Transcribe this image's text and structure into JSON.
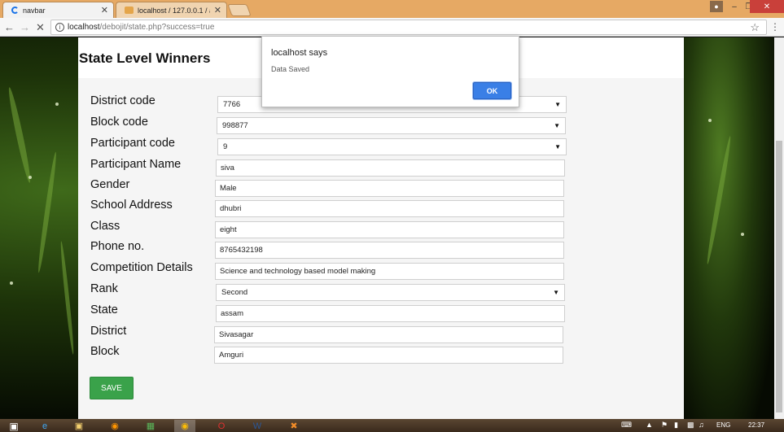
{
  "tabs": [
    {
      "title": "navbar",
      "close": "✕"
    },
    {
      "title": "localhost / 127.0.0.1 / ab",
      "close": "✕"
    }
  ],
  "address": {
    "host": "localhost",
    "path": "/debojit/state.php?success=true"
  },
  "page": {
    "title": "State Level Winners"
  },
  "form": {
    "fields": [
      {
        "label": "District code",
        "value": "7766",
        "type": "select"
      },
      {
        "label": "Block code",
        "value": "998877",
        "type": "select"
      },
      {
        "label": "Participant code",
        "value": "9",
        "type": "select"
      },
      {
        "label": "Participant Name",
        "value": "siva",
        "type": "text"
      },
      {
        "label": "Gender",
        "value": "Male",
        "type": "text"
      },
      {
        "label": "School Address",
        "value": "dhubri",
        "type": "text"
      },
      {
        "label": "Class",
        "value": "eight",
        "type": "text"
      },
      {
        "label": "Phone no.",
        "value": "8765432198",
        "type": "text"
      },
      {
        "label": "Competition Details",
        "value": "Science and technology based model making",
        "type": "text"
      },
      {
        "label": "Rank",
        "value": "Second",
        "type": "select"
      },
      {
        "label": "State",
        "value": "assam",
        "type": "text"
      },
      {
        "label": "District",
        "value": "Sivasagar",
        "type": "text"
      },
      {
        "label": "Block",
        "value": "Amguri",
        "type": "text"
      }
    ],
    "save_label": "SAVE"
  },
  "dialog": {
    "title": "localhost says",
    "message": "Data Saved",
    "ok_label": "OK"
  },
  "taskbar": {
    "language": "ENG",
    "time": "22:37"
  },
  "colors": {
    "tabbar": "#e6a964",
    "save_button": "#3aa24a",
    "ok_button": "#3a7fe6"
  }
}
